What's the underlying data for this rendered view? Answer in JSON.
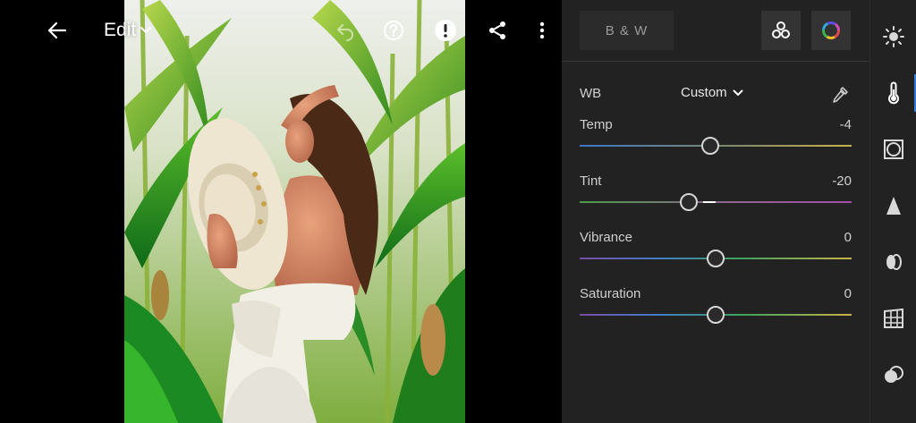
{
  "header": {
    "title": "Edit",
    "back_icon": "arrow-left-icon",
    "undo_icon": "undo-icon",
    "help_icon": "help-icon",
    "alert_icon": "alert-icon",
    "share_icon": "share-icon",
    "more_icon": "more-vertical-icon"
  },
  "photo": {
    "description_icon": "photo-woman-hat-cornfield"
  },
  "panel": {
    "bw_label": "B & W",
    "profiles_icon": "profiles-icon",
    "color_mix_icon": "color-wheel-icon",
    "wb": {
      "label": "WB",
      "value": "Custom",
      "eyedropper_icon": "eyedropper-icon"
    },
    "sliders": [
      {
        "key": "temp",
        "label": "Temp",
        "value": "-4",
        "min": -100,
        "max": 100,
        "num": -4
      },
      {
        "key": "tint",
        "label": "Tint",
        "value": "-20",
        "min": -100,
        "max": 100,
        "num": -20
      },
      {
        "key": "vibrance",
        "label": "Vibrance",
        "value": "0",
        "min": -100,
        "max": 100,
        "num": 0
      },
      {
        "key": "saturation",
        "label": "Saturation",
        "value": "0",
        "min": -100,
        "max": 100,
        "num": 0
      }
    ]
  },
  "rail": {
    "items": [
      {
        "name": "light-icon"
      },
      {
        "name": "color-temperature-icon",
        "active": true
      },
      {
        "name": "effects-icon"
      },
      {
        "name": "detail-icon"
      },
      {
        "name": "optics-icon"
      },
      {
        "name": "geometry-icon"
      },
      {
        "name": "mask-icon"
      }
    ]
  },
  "colors": {
    "accent": "#2f7bd8",
    "panel_bg": "#222222",
    "temp_track_left": "#3a78c8",
    "temp_track_right": "#c9b24a",
    "tint_track_left": "#4a9b4a",
    "tint_track_right": "#a24ca7"
  }
}
